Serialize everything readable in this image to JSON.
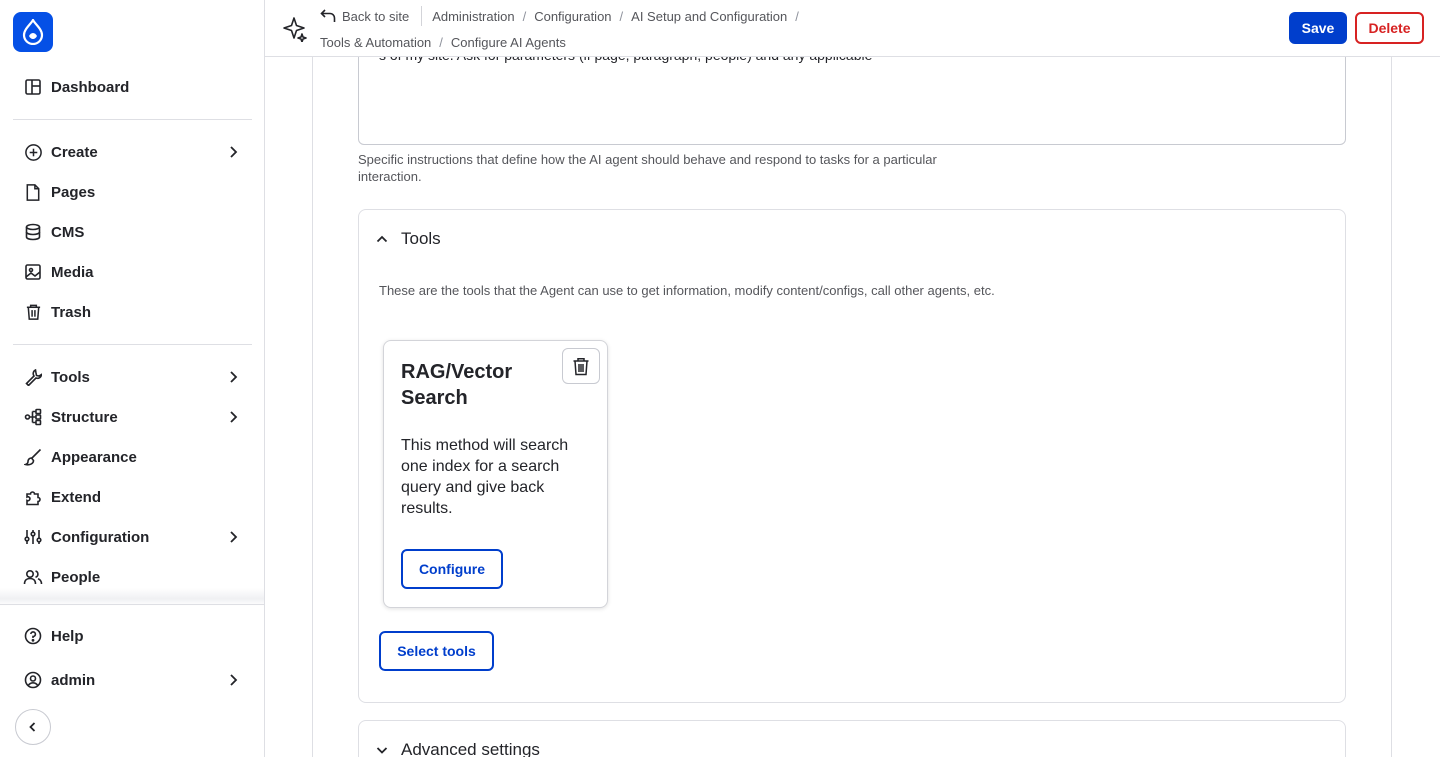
{
  "sidebar": {
    "items": [
      {
        "label": "Dashboard",
        "icon": "dashboard-icon"
      },
      {
        "label": "Create",
        "icon": "plus-circle-icon",
        "has_children": true
      },
      {
        "label": "Pages",
        "icon": "page-icon"
      },
      {
        "label": "CMS",
        "icon": "database-icon"
      },
      {
        "label": "Media",
        "icon": "media-icon"
      },
      {
        "label": "Trash",
        "icon": "trash-icon"
      },
      {
        "label": "Tools",
        "icon": "wrench-icon",
        "has_children": true
      },
      {
        "label": "Structure",
        "icon": "structure-icon",
        "has_children": true
      },
      {
        "label": "Appearance",
        "icon": "brush-icon"
      },
      {
        "label": "Extend",
        "icon": "puzzle-icon"
      },
      {
        "label": "Configuration",
        "icon": "sliders-icon",
        "has_children": true
      },
      {
        "label": "People",
        "icon": "people-icon"
      }
    ],
    "help_label": "Help",
    "user_label": "admin"
  },
  "topbar": {
    "back_label": "Back to site",
    "breadcrumbs": [
      "Administration",
      "Configuration",
      "AI Setup and Configuration",
      "Tools & Automation",
      "Configure AI Agents"
    ],
    "save_label": "Save",
    "delete_label": "Delete"
  },
  "main": {
    "instructions_text": "s of my site. Ask for parameters (if page, paragraph, people) and any applicable",
    "instructions_description": "Specific instructions that define how the AI agent should behave and respond to tasks for a particular interaction.",
    "tools_section": {
      "title": "Tools",
      "description": "These are the tools that the Agent can use to get information, modify content/configs, call other agents, etc.",
      "card": {
        "title": "RAG/Vector Search",
        "text": "This method will search one index for a search query and give back results.",
        "configure_label": "Configure"
      },
      "select_tools_label": "Select tools"
    },
    "advanced_section_title": "Advanced settings"
  },
  "colors": {
    "primary": "#003ecc",
    "danger": "#d72222",
    "logo_bg": "#0550e6"
  }
}
